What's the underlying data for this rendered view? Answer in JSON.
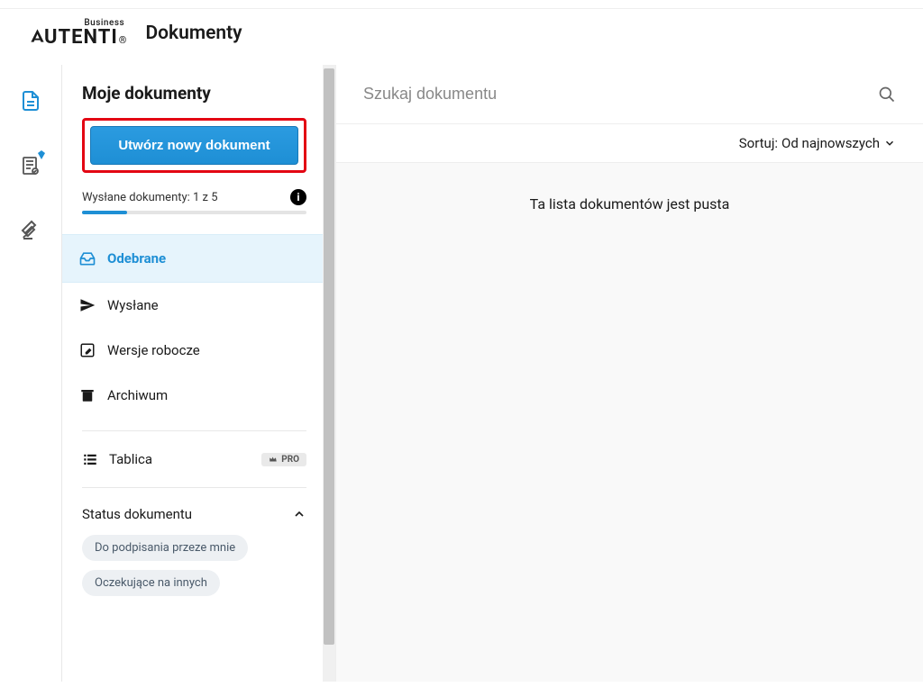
{
  "header": {
    "logo_small": "Business",
    "logo_main": "AUTENTI",
    "page_title": "Dokumenty"
  },
  "sidebar": {
    "title": "Moje dokumenty",
    "create_button": "Utwórz nowy dokument",
    "quota_label": "Wysłane dokumenty: 1 z 5",
    "folders": {
      "inbox": "Odebrane",
      "sent": "Wysłane",
      "drafts": "Wersje robocze",
      "archive": "Archiwum"
    },
    "tablica": {
      "label": "Tablica",
      "badge": "PRO"
    },
    "status": {
      "header": "Status dokumentu",
      "chips": {
        "to_sign": "Do podpisania przeze mnie",
        "waiting": "Oczekujące na innych"
      }
    }
  },
  "main": {
    "search_placeholder": "Szukaj dokumentu",
    "sort_label": "Sortuj:",
    "sort_value": "Od najnowszych",
    "empty_message": "Ta lista dokumentów jest pusta"
  },
  "colors": {
    "primary": "#1e8fd5",
    "highlight_border": "#e30613"
  }
}
